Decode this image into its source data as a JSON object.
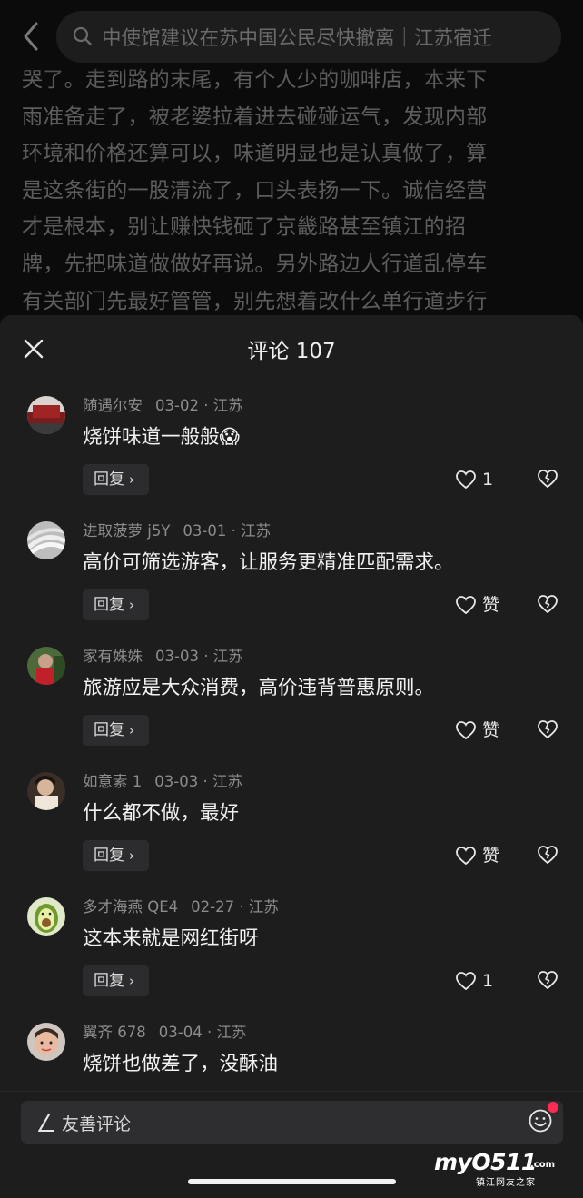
{
  "search": {
    "query": "中使馆建议在苏中国公民尽快撤离｜江苏宿迁"
  },
  "article": {
    "lines": [
      "哭了。走到路的末尾，有个人少的咖啡店，本来下",
      "雨准备走了，被老婆拉着进去碰碰运气，发现内部",
      "环境和价格还算可以，味道明显也是认真做了，算",
      "是这条街的一股清流了，口头表扬一下。诚信经营",
      "才是根本，别让赚快钱砸了京畿路甚至镇江的招",
      "牌，先把味道做做好再说。另外路边人行道乱停车",
      "有关部门先最好管管，别先想着改什么单行道步行"
    ]
  },
  "sheet": {
    "title": "评论 107"
  },
  "comments": [
    {
      "user": "随遇尔安",
      "date": "03-02",
      "region": "江苏",
      "text": "烧饼味道一般般😱",
      "reply": "回复",
      "likes": "1"
    },
    {
      "user": "进取菠萝 j5Y",
      "date": "03-01",
      "region": "江苏",
      "text": "高价可筛选游客，让服务更精准匹配需求。",
      "reply": "回复",
      "likes": "赞"
    },
    {
      "user": "家有姝姝",
      "date": "03-03",
      "region": "江苏",
      "text": "旅游应是大众消费，高价违背普惠原则。",
      "reply": "回复",
      "likes": "赞"
    },
    {
      "user": "如意素 1",
      "date": "03-03",
      "region": "江苏",
      "text": "什么都不做，最好",
      "reply": "回复",
      "likes": "赞"
    },
    {
      "user": "多才海燕 QE4",
      "date": "02-27",
      "region": "江苏",
      "text": "这本来就是网红街呀",
      "reply": "回复",
      "likes": "1"
    },
    {
      "user": "翼齐 678",
      "date": "03-04",
      "region": "江苏",
      "text": "烧饼也做差了，没酥油",
      "reply": "回复",
      "likes": ""
    }
  ],
  "separator": "·",
  "input": {
    "placeholder": "友善评论"
  },
  "watermark": {
    "main": "myO511",
    "domain": ".com",
    "sub": "镇江网友之家"
  },
  "colors": {
    "background": "#1d1d1e",
    "accent": "#fe2c55"
  }
}
